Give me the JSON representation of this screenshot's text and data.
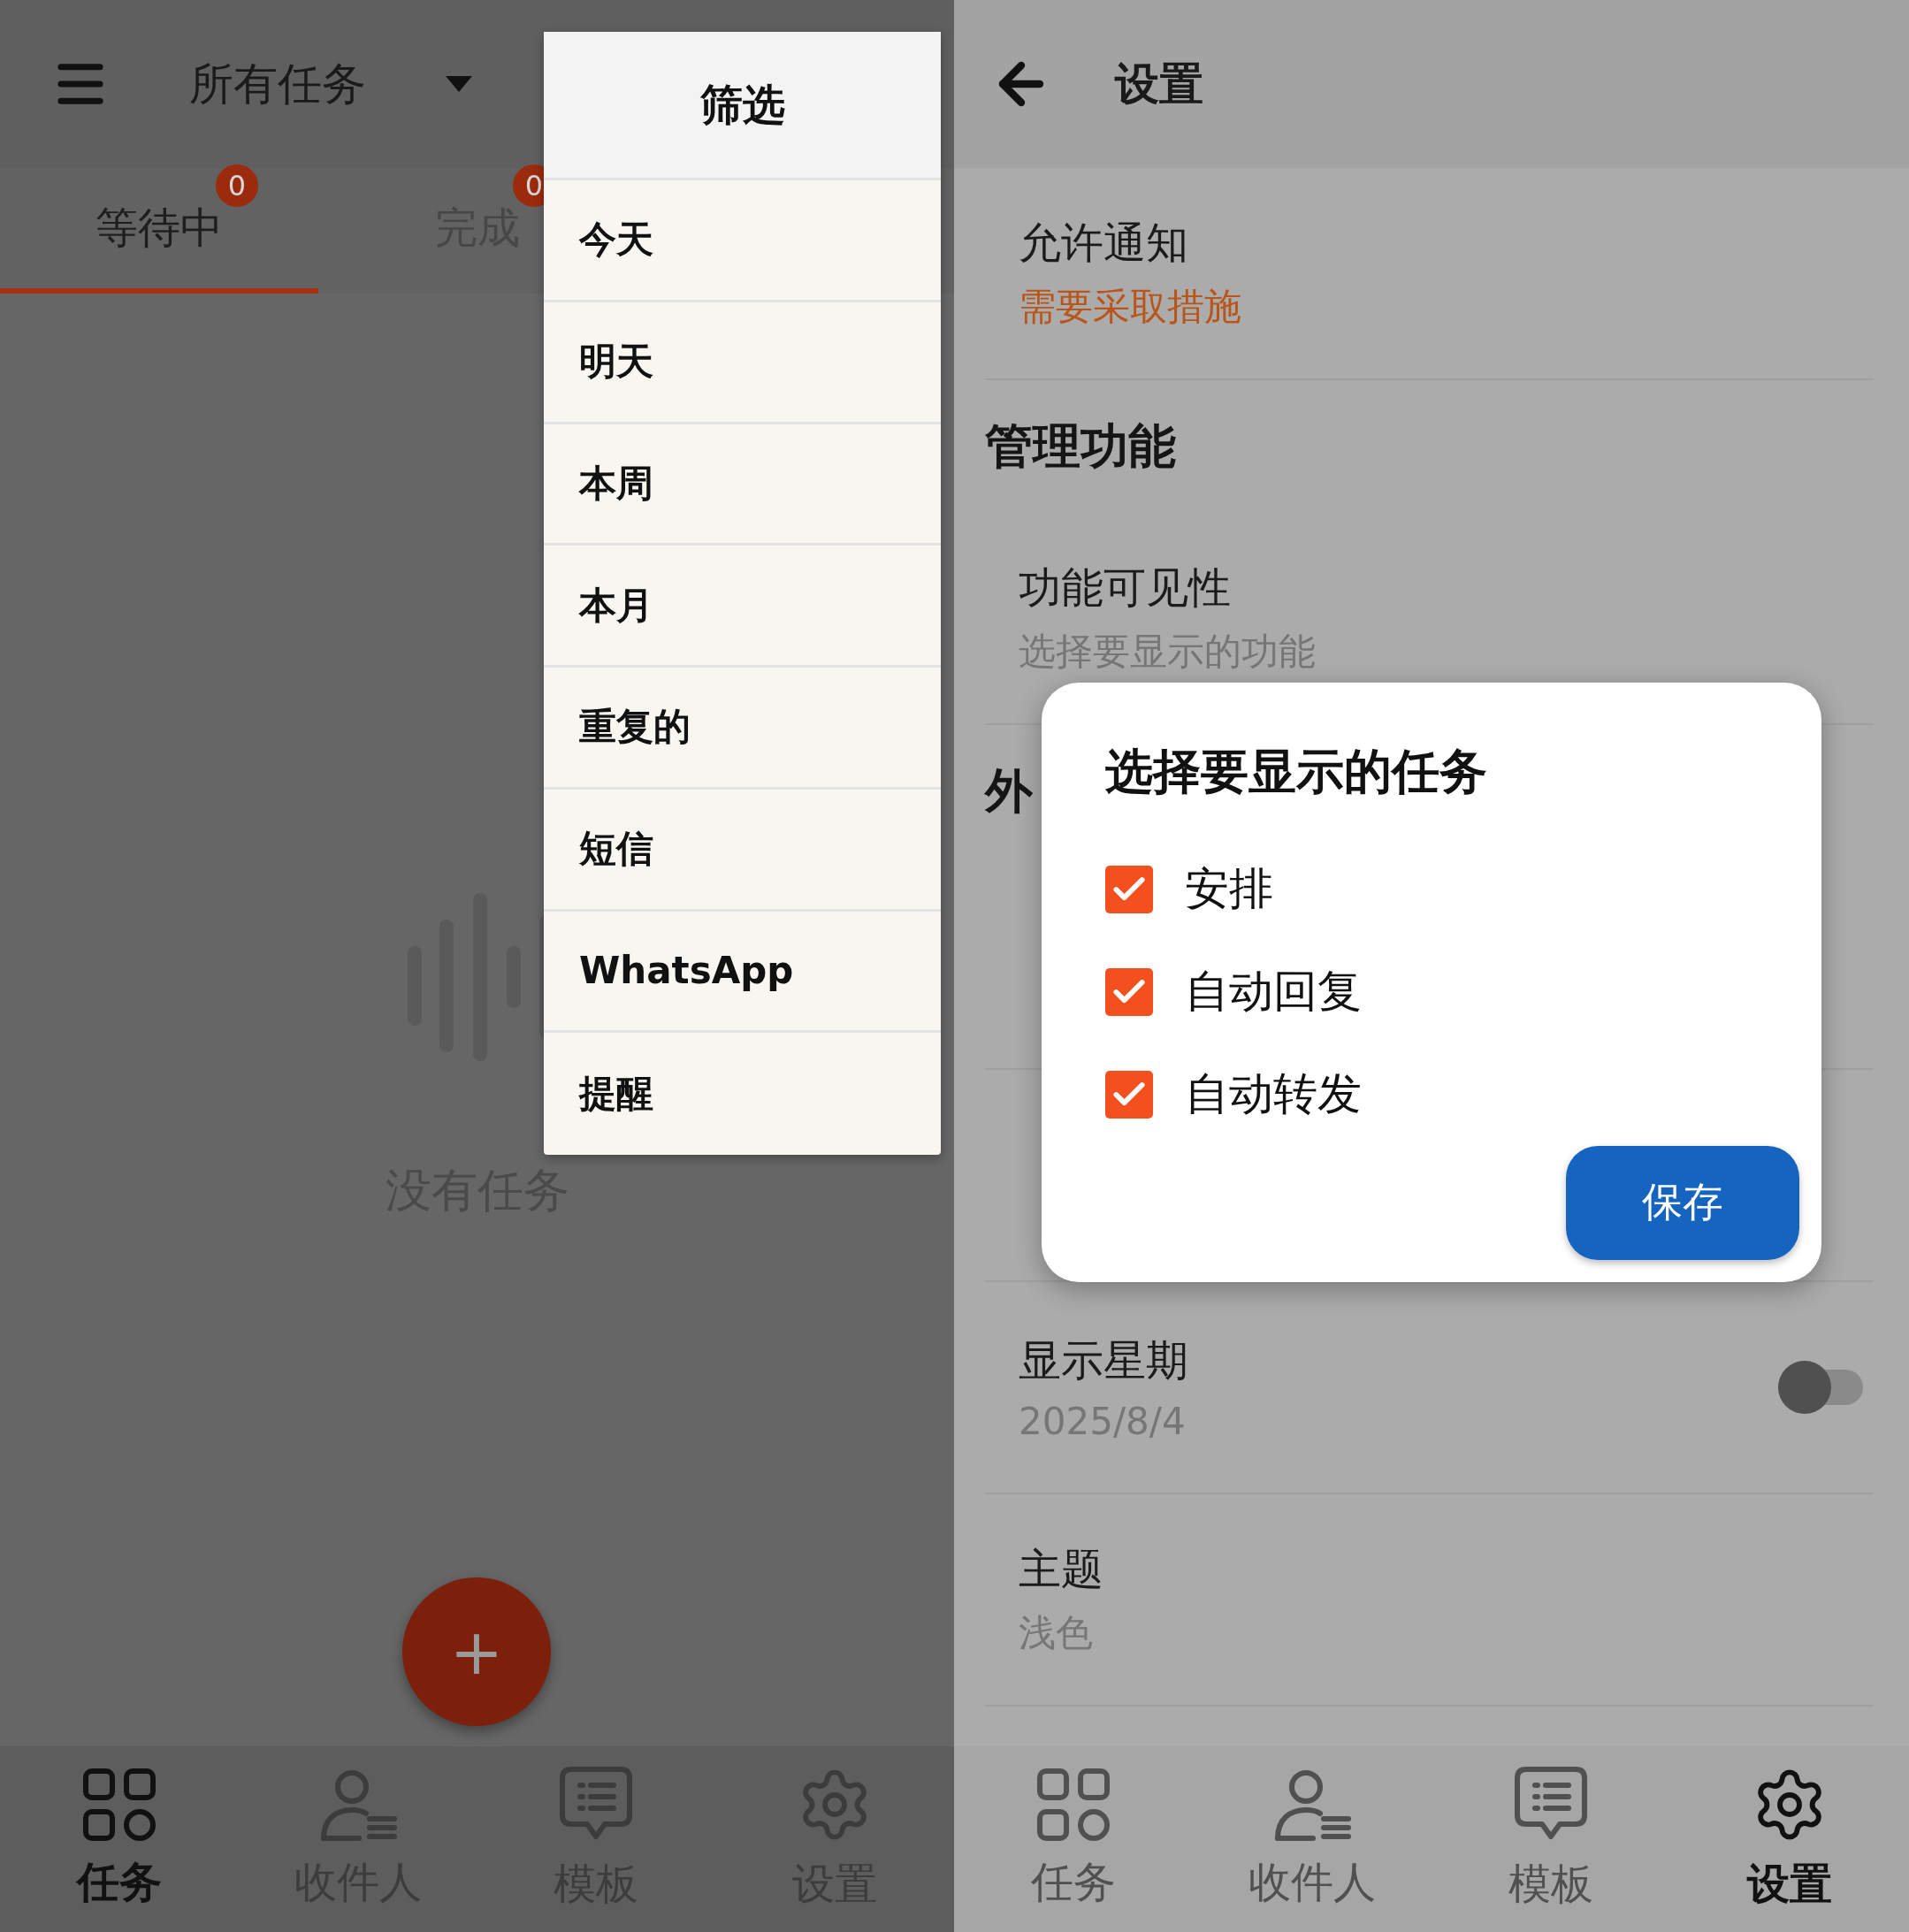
{
  "task_screen": {
    "header": {
      "title": "所有任务"
    },
    "tabs": [
      {
        "label": "等待中",
        "badge": "0",
        "selected": true
      },
      {
        "label": "完成",
        "badge": "0",
        "selected": false
      }
    ],
    "empty_state": {
      "message": "没有任务"
    },
    "fab": {
      "label": "+"
    },
    "filter_menu": {
      "title": "筛选",
      "items": [
        "今天",
        "明天",
        "本周",
        "本月",
        "重复的",
        "短信",
        "WhatsApp",
        "提醒"
      ]
    },
    "bottom_nav": [
      {
        "label": "任务",
        "selected": true
      },
      {
        "label": "收件人",
        "selected": false
      },
      {
        "label": "模板",
        "selected": false
      },
      {
        "label": "设置",
        "selected": false
      }
    ]
  },
  "settings_screen": {
    "header": {
      "title": "设置"
    },
    "list": [
      {
        "kind": "item",
        "title": "允许通知",
        "subtitle": "需要采取措施",
        "alert": true
      },
      {
        "kind": "section",
        "title": "管理功能"
      },
      {
        "kind": "item",
        "title": "功能可见性",
        "subtitle": "选择要显示的功能",
        "alert": false
      },
      {
        "kind": "section",
        "title": "外"
      },
      {
        "kind": "covered"
      },
      {
        "kind": "covered"
      },
      {
        "kind": "toggle",
        "title": "显示星期",
        "subtitle": "2025/8/4",
        "on": false
      },
      {
        "kind": "item",
        "title": "主题",
        "subtitle": "浅色",
        "alert": false
      }
    ],
    "dialog": {
      "title": "选择要显示的任务",
      "options": [
        {
          "label": "安排",
          "checked": true
        },
        {
          "label": "自动回复",
          "checked": true
        },
        {
          "label": "自动转发",
          "checked": true
        }
      ],
      "button": "保存"
    },
    "bottom_nav": [
      {
        "label": "任务",
        "selected": false
      },
      {
        "label": "收件人",
        "selected": false
      },
      {
        "label": "模板",
        "selected": false
      },
      {
        "label": "设置",
        "selected": true
      }
    ]
  }
}
